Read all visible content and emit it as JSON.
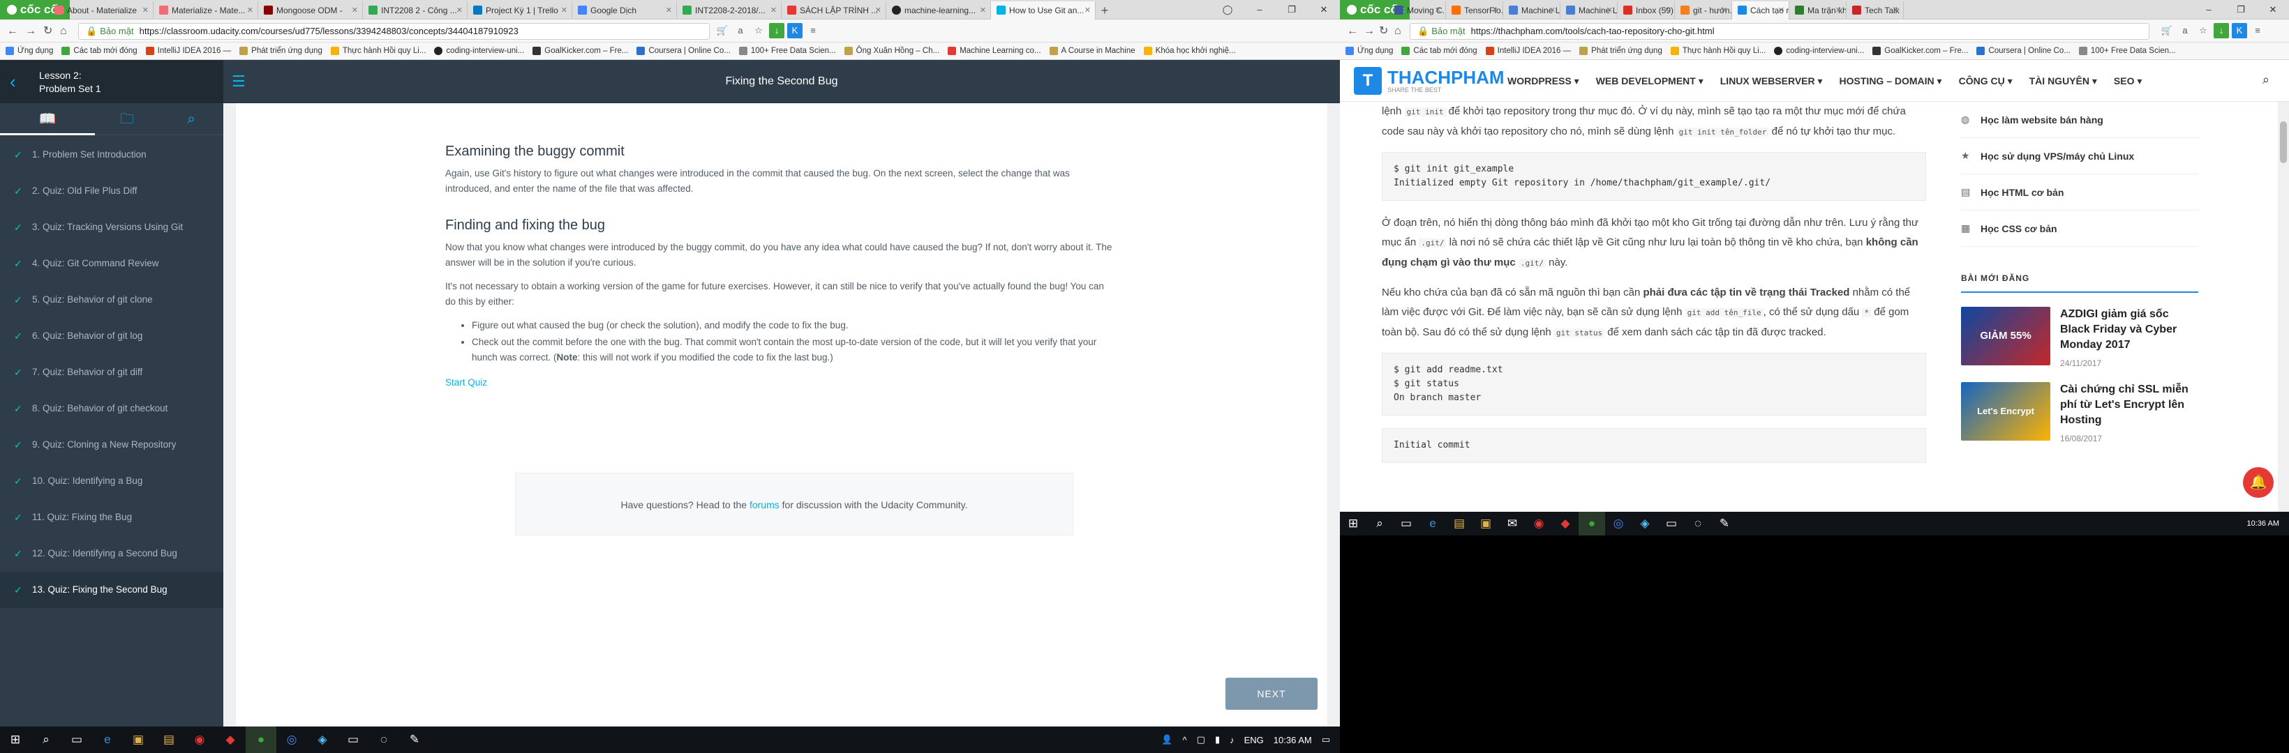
{
  "left": {
    "browser_brand": "cốc cốc",
    "tabs": [
      "About - Materialize",
      "Materialize - Mate...",
      "Mongoose ODM -",
      "INT2208 2 - Công ...",
      "Project Kỳ 1 | Trello",
      "Google Dịch",
      "INT2208-2-2018/...",
      "SÁCH LẬP TRÌNH ...",
      "machine-learning...",
      "How to Use Git an..."
    ],
    "active_tab": 9,
    "secure_label": "Bảo mật",
    "url": "https://classroom.udacity.com/courses/ud775/lessons/3394248803/concepts/34404187910923",
    "bookmarks": [
      "Ứng dụng",
      "Các tab mới đóng",
      "IntelliJ IDEA 2016 —",
      "Phát triển ứng dụng",
      "Thực hành Hồi quy Li...",
      "coding-interview-uni...",
      "GoalKicker.com – Fre...",
      "Coursera | Online Co...",
      "100+ Free Data Scien...",
      "Ông Xuân Hồng – Ch...",
      "Machine Learning co...",
      "A Course in Machine",
      "Khóa học khởi nghiệ..."
    ],
    "lesson": {
      "line1": "Lesson 2:",
      "line2": "Problem Set 1"
    },
    "concepts": [
      "1. Problem Set Introduction",
      "2. Quiz: Old File Plus Diff",
      "3. Quiz: Tracking Versions Using Git",
      "4. Quiz: Git Command Review",
      "5. Quiz: Behavior of git clone",
      "6. Quiz: Behavior of git log",
      "7. Quiz: Behavior of git diff",
      "8. Quiz: Behavior of git checkout",
      "9. Quiz: Cloning a New Repository",
      "10. Quiz: Identifying a Bug",
      "11. Quiz: Fixing the Bug",
      "12. Quiz: Identifying a Second Bug",
      "13. Quiz: Fixing the Second Bug"
    ],
    "current_concept": 12,
    "page_title": "Fixing the Second Bug",
    "section1_title": "Examining the buggy commit",
    "section1_text": "Again, use Git's history to figure out what changes were introduced in the commit that caused the bug. On the next screen, select the change that was introduced, and enter the name of the file that was affected.",
    "section2_title": "Finding and fixing the bug",
    "section2_text": "Now that you know what changes were introduced by the buggy commit, do you have any idea what could have caused the bug? If not, don't worry about it. The answer will be in the solution if you're curious.",
    "section2_text2": "It's not necessary to obtain a working version of the game for future exercises. However, it can still be nice to verify that you've actually found the bug! You can do this by either:",
    "bullet1": "Figure out what caused the bug (or check the solution), and modify the code to fix the bug.",
    "bullet2a": "Check out the commit before the one with the bug. That commit won't contain the most up-to-date version of the code, but it will let you verify that your hunch was correct. (",
    "bullet2_note": "Note",
    "bullet2b": ": this will not work if you modified the code to fix the last bug.)",
    "start_quiz": "Start Quiz",
    "forum_pre": "Have questions? Head to the ",
    "forum_link": "forums",
    "forum_post": " for discussion with the Udacity Community.",
    "next_label": "NEXT",
    "taskbar": {
      "lang": "ENG",
      "time": "10:36 AM"
    }
  },
  "right": {
    "browser_brand": "cốc cốc",
    "tabs": [
      "Moving C...",
      "TensorFlo...",
      "Machine L...",
      "Machine L...",
      "Inbox (59)",
      "git - hướn...",
      "Cách tạo r...",
      "Ma trận kh...",
      "Tech Talk"
    ],
    "active_tab": 6,
    "secure_label": "Bảo mật",
    "url": "https://thachpham.com/tools/cach-tao-repository-cho-git.html",
    "bookmarks": [
      "Ứng dụng",
      "Các tab mới đóng",
      "IntelliJ IDEA 2016 —",
      "Phát triển ứng dụng",
      "Thực hành Hồi quy Li...",
      "coding-interview-uni...",
      "GoalKicker.com – Fre...",
      "Coursera | Online Co...",
      "100+ Free Data Scien..."
    ],
    "logo_name": "THACHPHAM",
    "logo_tag": "SHARE THE BEST",
    "menu": [
      "WORDPRESS ▾",
      "WEB DEVELOPMENT ▾",
      "LINUX WEBSERVER ▾",
      "HOSTING – DOMAIN ▾",
      "CÔNG CỤ ▾",
      "TÀI NGUYÊN ▾",
      "SEO ▾"
    ],
    "p1a": "lệnh ",
    "p1_code1": "git init",
    "p1b": " để khởi tạo repository trong thư mục đó. Ở ví dụ này, mình sẽ tạo tạo ra một thư mục mới để chứa code sau này và khởi tạo repository cho nó, mình sẽ dùng lệnh ",
    "p1_code2": "git init tên_folder",
    "p1c": " để nó tự khởi tạo thư mục.",
    "code1": "$ git init git_example\nInitialized empty Git repository in /home/thachpham/git_example/.git/",
    "p2a": "Ở đoạn trên, nó hiển thị dòng thông báo mình đã khởi tạo một kho Git trống tại đường dẫn như trên. Lưu ý rằng thư mục ẩn ",
    "p2_code1": ".git/",
    "p2b": " là nơi nó sẽ chứa các thiết lập về Git cũng như lưu lại toàn bộ thông tin về kho chứa, bạn ",
    "p2_bold": "không cần đụng chạm gì vào thư mục",
    "p2_code2": ".git/",
    "p2c": " này.",
    "p3a": "Nếu kho chứa của bạn đã có sẵn mã nguồn thì bạn cần ",
    "p3_bold": "phải đưa các tập tin về trạng thái Tracked",
    "p3b": " nhằm có thể làm việc được với Git. Để làm việc này, bạn sẽ cần sử dụng lệnh ",
    "p3_code1": "git add tên_file",
    "p3c": ", có thể sử dụng dấu ",
    "p3_code2": "*",
    "p3d": " để gom toàn bộ. Sau đó có thể sử dụng lệnh ",
    "p3_code3": "git status",
    "p3e": " để xem danh sách các tập tin đã được tracked.",
    "code2": "$ git add readme.txt\n$ git status\nOn branch master",
    "code3": "Initial commit",
    "side_links": [
      "Học làm website bán hàng",
      "Học sử dụng VPS/máy chủ Linux",
      "Học HTML cơ bản",
      "Học CSS cơ bản"
    ],
    "new_posts_heading": "BÀI MỚI ĐĂNG",
    "posts": [
      {
        "title": "AZDIGI giảm giá sốc Black Friday và Cyber Monday 2017",
        "date": "24/11/2017",
        "badge": "GIẢM 55%"
      },
      {
        "title": "Cài chứng chỉ SSL miễn phí từ Let's Encrypt lên Hosting",
        "date": "16/08/2017",
        "badge": "Let's Encrypt"
      }
    ],
    "taskbar_time": "10:36 AM"
  }
}
